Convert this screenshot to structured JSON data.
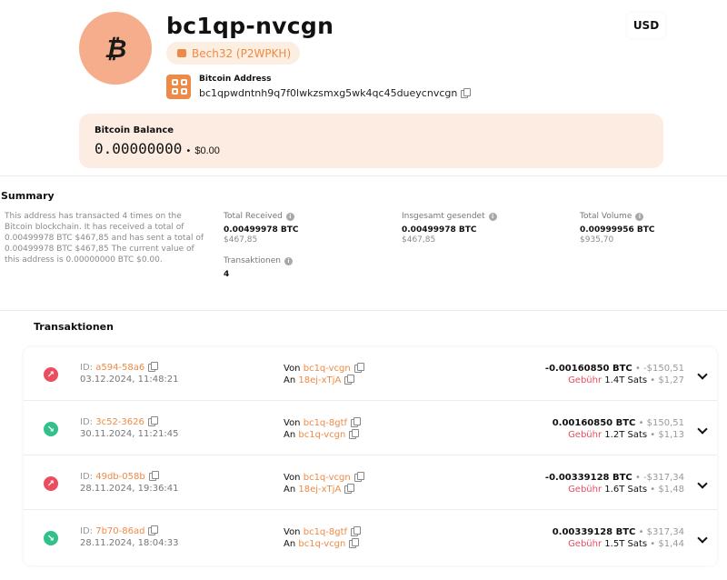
{
  "header": {
    "avatar_symbol": "₿",
    "title": "bc1qp-nvcgn",
    "address_type": "Bech32 (P2WPKH)",
    "address_label": "Bitcoin Address",
    "address_full": "bc1qpwdntnh9q7f0lwkzsmxg5wk4qc45dueycnvcgn",
    "currency": "USD"
  },
  "balance": {
    "label": "Bitcoin Balance",
    "btc": "0.00000000",
    "dot": "•",
    "fiat": "$0.00"
  },
  "summary": {
    "title": "Summary",
    "text": "This address has transacted 4 times on the Bitcoin blockchain. It has received a total of 0.00499978 BTC $467,85 and has sent a total of 0.00499978 BTC $467,85 The current value of this address is 0.00000000 BTC $0.00.",
    "stats": [
      {
        "label": "Total Received",
        "value": "0.00499978 BTC",
        "sub": "$467,85"
      },
      {
        "label": "Insgesamt gesendet",
        "value": "0.00499978 BTC",
        "sub": "$467,85"
      },
      {
        "label": "Total Volume",
        "value": "0.00999956 BTC",
        "sub": "$935,70"
      },
      {
        "label": "Transaktionen",
        "value": "4",
        "sub": ""
      }
    ]
  },
  "transactions": {
    "title": "Transaktionen",
    "id_prefix": "ID:",
    "from_label": "Von",
    "to_label": "An",
    "fee_label": "Gebühr",
    "items": [
      {
        "direction": "out",
        "id": "a594-58a6",
        "date": "03.12.2024, 11:48:21",
        "from": "bc1q-vcgn",
        "to": "18ej-xTjA",
        "btc": "-0.00160850 BTC",
        "fiat": "• -$150,51",
        "fee": "1.4T Sats",
        "fee_fiat": "• $1,27"
      },
      {
        "direction": "in",
        "id": "3c52-3626",
        "date": "30.11.2024, 11:21:45",
        "from": "bc1q-8gtf",
        "to": "bc1q-vcgn",
        "btc": "0.00160850 BTC",
        "fiat": "• $150,51",
        "fee": "1.2T Sats",
        "fee_fiat": "• $1,13"
      },
      {
        "direction": "out",
        "id": "49db-058b",
        "date": "28.11.2024, 19:36:41",
        "from": "bc1q-vcgn",
        "to": "18ej-xTjA",
        "btc": "-0.00339128 BTC",
        "fiat": "• -$317,34",
        "fee": "1.6T Sats",
        "fee_fiat": "• $1,48"
      },
      {
        "direction": "in",
        "id": "7b70-86ad",
        "date": "28.11.2024, 18:04:33",
        "from": "bc1q-8gtf",
        "to": "bc1q-vcgn",
        "btc": "0.00339128 BTC",
        "fiat": "• $317,34",
        "fee": "1.5T Sats",
        "fee_fiat": "• $1,44"
      }
    ]
  },
  "colors": {
    "accent": "#ee8a45",
    "outgoing": "#ea4c60",
    "incoming": "#33c18b",
    "balance_bg": "#fdece1"
  }
}
